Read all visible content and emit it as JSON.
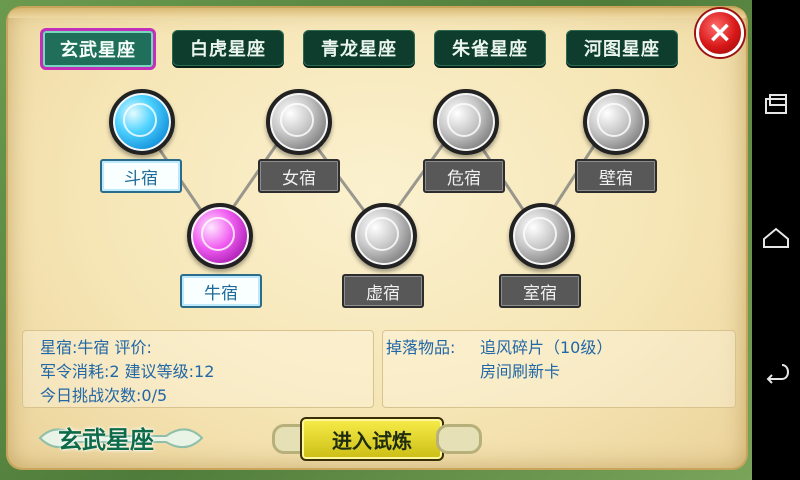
{
  "tabs": [
    {
      "label": "玄武星座",
      "active": true
    },
    {
      "label": "白虎星座",
      "active": false
    },
    {
      "label": "青龙星座",
      "active": false
    },
    {
      "label": "朱雀星座",
      "active": false
    },
    {
      "label": "河图星座",
      "active": false
    }
  ],
  "stars": [
    {
      "label": "斗宿",
      "state": "lit",
      "color": "blue"
    },
    {
      "label": "女宿",
      "state": "locked",
      "color": "gray"
    },
    {
      "label": "危宿",
      "state": "locked",
      "color": "gray"
    },
    {
      "label": "壁宿",
      "state": "locked",
      "color": "gray"
    },
    {
      "label": "牛宿",
      "state": "lit",
      "color": "pink"
    },
    {
      "label": "虚宿",
      "state": "locked",
      "color": "gray"
    },
    {
      "label": "室宿",
      "state": "locked",
      "color": "gray"
    }
  ],
  "info_left": {
    "line1": "星宿:牛宿  评价:",
    "line2": "军令消耗:2  建议等级:12",
    "line3": "今日挑战次数:0/5"
  },
  "info_right": {
    "drops_label": "掉落物品:",
    "drop1": "追风碎片（10级）",
    "drop2": "房间刷新卡"
  },
  "bottom": {
    "constellation_title": "玄武星座",
    "enter_label": "进入试炼"
  },
  "close_icon": "×",
  "colors": {
    "tab_bg": "#0f3d2d",
    "tab_active_border": "#c22fb8",
    "info_text": "#2167a6",
    "enter_button": "#e9dc2e"
  },
  "icons": {
    "close": "close-icon",
    "recent": "recent-apps-icon",
    "home": "home-icon",
    "back": "back-icon"
  }
}
